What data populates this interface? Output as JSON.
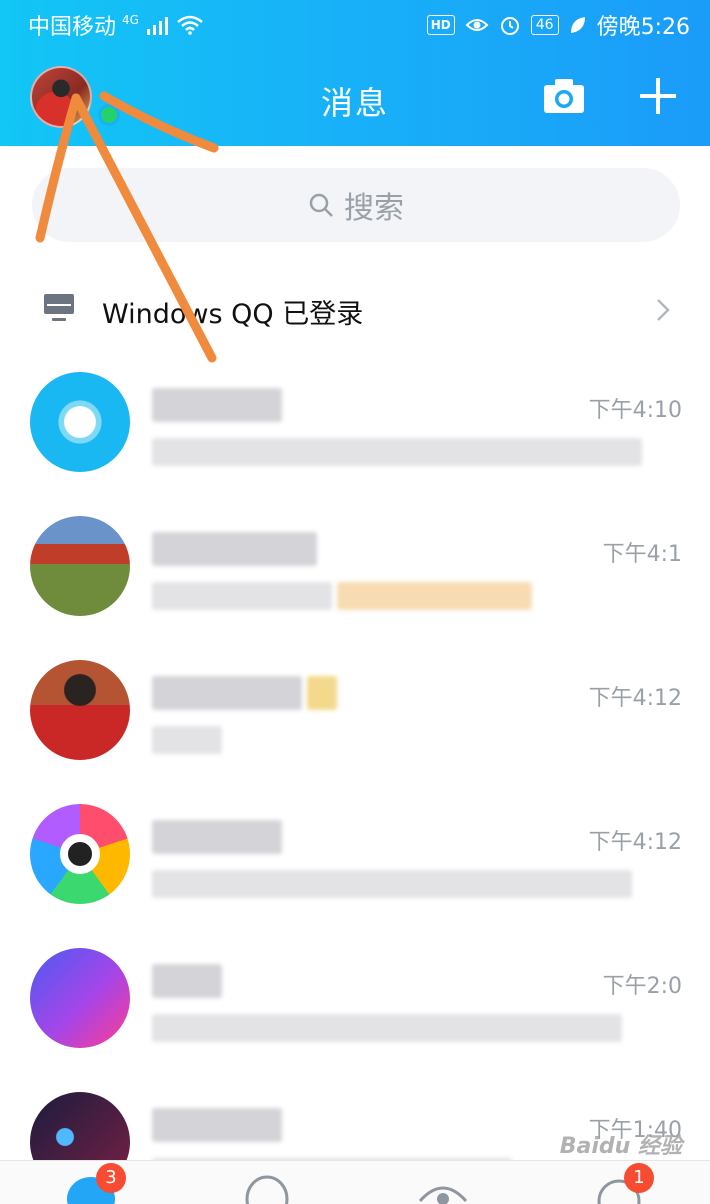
{
  "status_bar": {
    "carrier": "中国移动",
    "network": "4G",
    "hd_label": "HD",
    "battery": "46",
    "time": "傍晚5:26"
  },
  "header": {
    "title": "消息",
    "camera_icon": "camera-icon",
    "plus_icon": "plus-icon"
  },
  "search": {
    "placeholder": "搜索"
  },
  "login_banner": {
    "text": "Windows QQ 已登录"
  },
  "chats": [
    {
      "time": "下午4:10"
    },
    {
      "time": "下午4:1"
    },
    {
      "time": "下午4:12"
    },
    {
      "time": "下午4:12"
    },
    {
      "time": "下午2:0"
    },
    {
      "time": "下午1:40"
    }
  ],
  "tabs": {
    "messages_badge": "3",
    "dynamic_badge": "1"
  },
  "watermark": "Baidu 经验",
  "colors": {
    "header_start": "#12c6f5",
    "header_end": "#1a9cf9",
    "annotation": "#f08a3c",
    "badge": "#f74c31"
  }
}
